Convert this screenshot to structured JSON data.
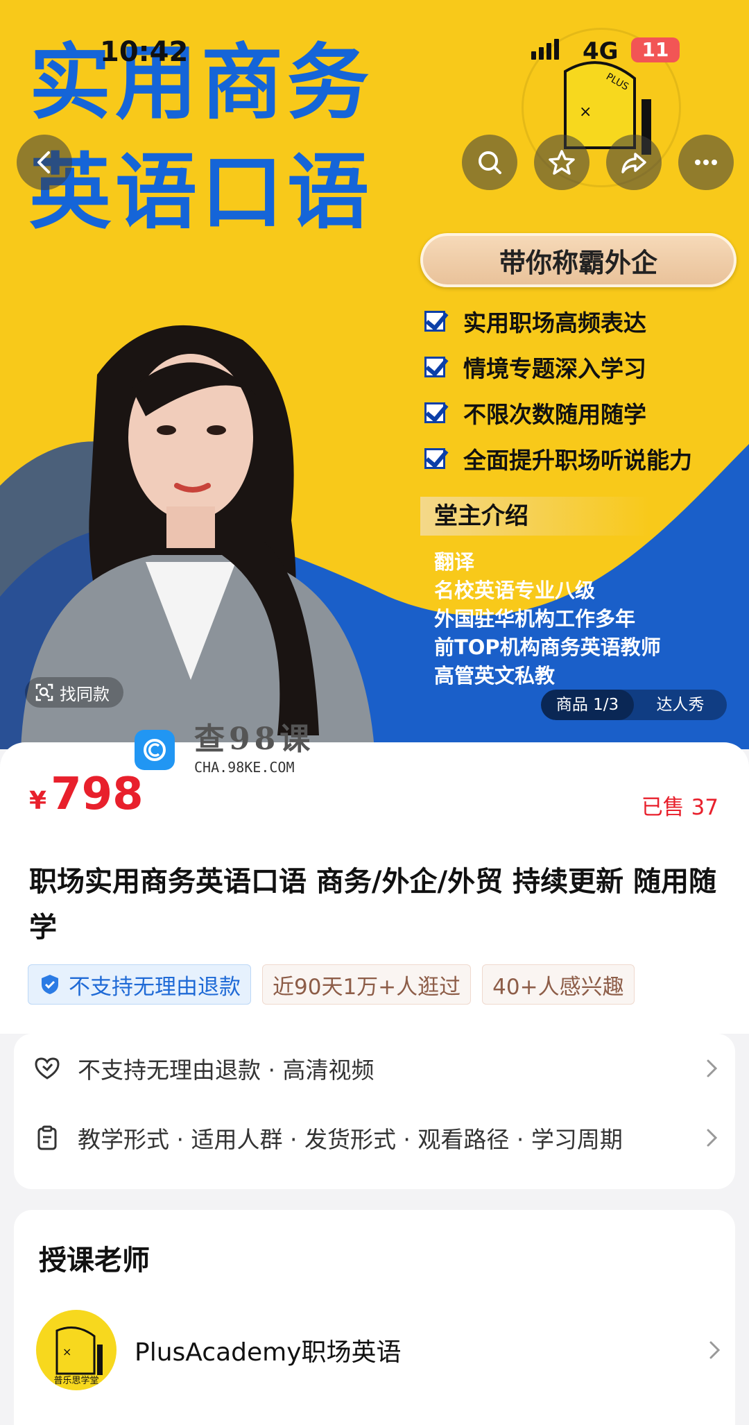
{
  "status_bar": {
    "time": "10:42",
    "network": "4G",
    "battery": "11"
  },
  "hero": {
    "title_line1": "实用商务",
    "title_line2": "英语口语",
    "badge": "带你称霸外企",
    "features": [
      "实用职场高频表达",
      "情境专题深入学习",
      "不限次数随用随学",
      "全面提升职场听说能力"
    ],
    "intro_title": "堂主介绍",
    "intro_items": [
      "翻译",
      "名校英语专业八级",
      "外国驻华机构工作多年",
      "前TOP机构商务英语教师",
      "高管英文私教"
    ],
    "logo_text": "普乐思学堂",
    "logo_plus": "PLUS"
  },
  "nav": {
    "back_icon": "chevron-left-icon",
    "search_icon": "search-icon",
    "favorite_icon": "star-icon",
    "share_icon": "share-icon",
    "more_icon": "more-icon"
  },
  "overlay": {
    "find_same": "找同款",
    "gallery_tabs": [
      "商品 1/3",
      "达人秀"
    ]
  },
  "watermark": {
    "main": "查98课",
    "sub": "CHA.98KE.COM"
  },
  "product": {
    "currency": "¥",
    "price": "798",
    "sold": "已售 37",
    "title": "职场实用商务英语口语 商务/外企/外贸 持续更新 随用随学",
    "tags": [
      "不支持无理由退款",
      "近90天1万+人逛过",
      "40+人感兴趣"
    ]
  },
  "info": {
    "row1": "不支持无理由退款 · 高清视频",
    "row2": "教学形式 · 适用人群 · 发货形式 · 观看路径 · 学习周期"
  },
  "teacher": {
    "heading": "授课老师",
    "name": "PlusAcademy职场英语",
    "avatar_text": "普乐思学堂"
  },
  "colors": {
    "hero_yellow": "#f8c91a",
    "hero_blue": "#1565d8",
    "price_red": "#e8202c"
  }
}
